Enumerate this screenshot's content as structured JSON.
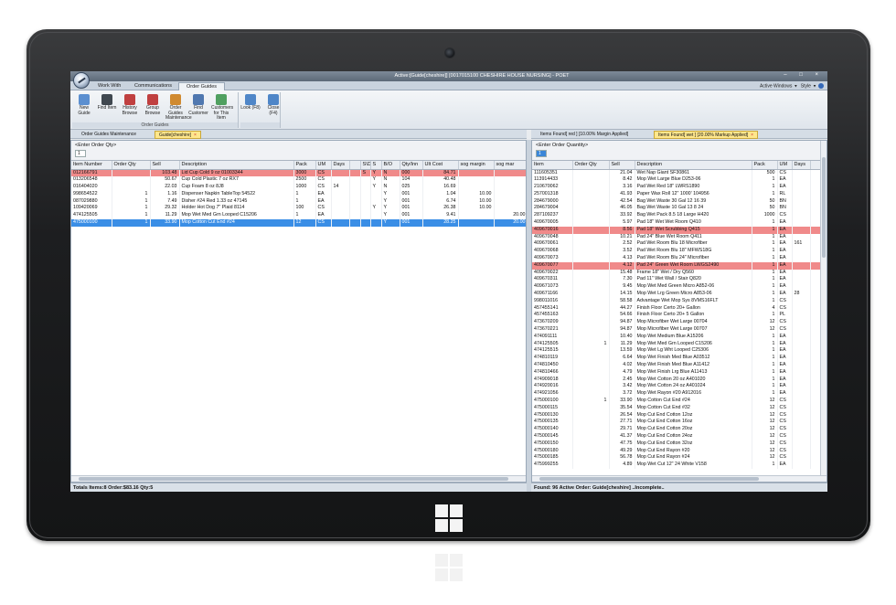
{
  "window": {
    "title": "Active:[Guide[cheshire]] [0017015100 CHESHIRE HOUSE NURSING] - POET",
    "controls": "– □ ×",
    "active_windows": "Active Windows",
    "style": "Style"
  },
  "ribbon_tabs": [
    "Work With",
    "Communications",
    "Order Guides"
  ],
  "ribbon": {
    "group_label": "Order Guides",
    "buttons": [
      {
        "label": "New Guide",
        "icon": "new-guide-icon",
        "color": "#5b8fd0"
      },
      {
        "label": "Find Item",
        "icon": "binoculars-icon",
        "color": "#404850"
      },
      {
        "label": "History Browse",
        "icon": "history-icon",
        "color": "#c04040"
      },
      {
        "label": "Group Browse",
        "icon": "group-icon",
        "color": "#c04040"
      },
      {
        "label": "Order Guides Maintenance",
        "icon": "tools-icon",
        "color": "#d08a30"
      },
      {
        "label": "Find Customer",
        "icon": "customer-icon",
        "color": "#5078b0"
      },
      {
        "label": "Customers for This Item",
        "icon": "customers-icon",
        "color": "#50a060"
      }
    ],
    "nav_buttons": [
      {
        "label": "Look (F8)",
        "icon": "magnifier-icon",
        "color": "#4f86c8"
      },
      {
        "label": "Close (F4)",
        "icon": "close-doc-icon",
        "color": "#4f86c8"
      }
    ]
  },
  "left": {
    "tabs": [
      {
        "label": "Order Guides Maintenance",
        "active": false
      },
      {
        "label": "Guide[cheshire]",
        "active": true
      }
    ],
    "enter_label": "<Enter Order Qty>",
    "entry_value": "1",
    "columns": [
      "Item Number",
      "Order Qty",
      "Sell",
      "Description",
      "Pack",
      "UM",
      "Days",
      "",
      "S\\D",
      "S",
      "B/O",
      "Qty/Inn",
      "Ult Cost",
      "sog margin",
      "sog mar"
    ],
    "rows": [
      {
        "style": "red",
        "cells": [
          "012166791",
          "",
          "103.48",
          "Lid Cup Cold 9 oz        01003344",
          "3000",
          "CS",
          "",
          "",
          "S",
          "Y",
          "N",
          "000",
          "84.71",
          "",
          ""
        ]
      },
      {
        "style": "",
        "cells": [
          "013206548",
          "",
          "50.67",
          "Cup Cold Plastic 7 oz           RX7",
          "2500",
          "CS",
          "",
          "",
          "",
          "Y",
          "N",
          "104",
          "40.48",
          "",
          ""
        ]
      },
      {
        "style": "",
        "cells": [
          "016404020",
          "",
          "22.03",
          "Cup Foam 8 oz                   8J8",
          "1000",
          "CS",
          "14",
          "",
          "",
          "Y",
          "N",
          "025",
          "16.69",
          "",
          ""
        ]
      },
      {
        "style": "",
        "cells": [
          "998654522",
          "1",
          "1.16",
          "Dispenser Napkin TableTop 54522",
          "1",
          "EA",
          "",
          "",
          "",
          "",
          "Y",
          "001",
          "1.04",
          "10.00",
          ""
        ]
      },
      {
        "style": "",
        "cells": [
          "087029880",
          "1",
          "7.49",
          "Disher #24 Red 1.33 oz     47145",
          "1",
          "EA",
          "",
          "",
          "",
          "",
          "Y",
          "001",
          "6.74",
          "10.00",
          ""
        ]
      },
      {
        "style": "",
        "cells": [
          "109420069",
          "1",
          "29.32",
          "Holder Hot Dog 7\" Plaid    8114",
          "100",
          "CS",
          "",
          "",
          "",
          "Y",
          "Y",
          "001",
          "26.38",
          "10.00",
          ""
        ]
      },
      {
        "style": "",
        "cells": [
          "474125505",
          "1",
          "11.29",
          "Mop Wet Med Grn Looped   C15206",
          "1",
          "EA",
          "",
          "",
          "",
          "",
          "Y",
          "001",
          "9.41",
          "",
          "20.00"
        ]
      },
      {
        "style": "sel",
        "cells": [
          "475000100",
          "1",
          "33.90",
          "Mop Cotton Cut End #24",
          "12",
          "CS",
          "",
          "",
          "",
          "",
          "Y",
          "001",
          "28.25",
          "",
          "20.00"
        ]
      }
    ],
    "status": "Totals Items:8 Order:$83.16 Qty:5"
  },
  "right": {
    "tabs": [
      {
        "label": "Items Found[ red ] [10.00% Margin Applied]",
        "active": false
      },
      {
        "label": "Items Found[ wet ] [20.00% Markup Applied]",
        "active": true
      }
    ],
    "enter_label": "<Enter Order Quantity>",
    "entry_value": "1",
    "columns": [
      "Item",
      "Order Qty",
      "Sell",
      "Description",
      "Pack",
      "UM",
      "Days",
      ""
    ],
    "rows": [
      {
        "style": "",
        "cells": [
          "111605351",
          "",
          "21.04",
          "Wet Nap Giant          SF30861",
          "500",
          "CS",
          "",
          ""
        ]
      },
      {
        "style": "",
        "cells": [
          "113914433",
          "",
          "8.42",
          "Mop Wet Large Blue      D253-06",
          "1",
          "EA",
          "",
          ""
        ]
      },
      {
        "style": "",
        "cells": [
          "210670062",
          "",
          "3.16",
          "Pad Wet Red 18\"         LWRS1890",
          "1",
          "EA",
          "",
          ""
        ]
      },
      {
        "style": "",
        "cells": [
          "257001318",
          "",
          "41.93",
          "Paper Wax Roll 12\" 1000' 104956",
          "1",
          "RL",
          "",
          ""
        ]
      },
      {
        "style": "",
        "cells": [
          "284679000",
          "",
          "42.54",
          "Bag Wet Waste 30 Gal 12 16 39",
          "50",
          "BN",
          "",
          ""
        ]
      },
      {
        "style": "",
        "cells": [
          "284679004",
          "",
          "46.05",
          "Bag Wet Waste 10 Gal 13 8 24",
          "50",
          "BN",
          "",
          ""
        ]
      },
      {
        "style": "",
        "cells": [
          "287109237",
          "",
          "33.92",
          "Bag Wet Pack 8.5 18 Large  H420",
          "1000",
          "CS",
          "",
          ""
        ]
      },
      {
        "style": "",
        "cells": [
          "409670005",
          "",
          "5.97",
          "Pad 18\" Wet Wet Room       Q410",
          "1",
          "EA",
          "",
          ""
        ]
      },
      {
        "style": "red",
        "cells": [
          "409670016",
          "",
          "8.56",
          "Pad 18\" Wet Scrubbing      Q415",
          "1",
          "EA",
          "",
          ""
        ]
      },
      {
        "style": "",
        "cells": [
          "409670048",
          "",
          "10.21",
          "Pad 24\" Blue Wet Room      Q411",
          "1",
          "EA",
          "",
          ""
        ]
      },
      {
        "style": "",
        "cells": [
          "409670061",
          "",
          "2.52",
          "Pad Wet Room Blu 18 Microfiber",
          "1",
          "EA",
          "161",
          ""
        ]
      },
      {
        "style": "",
        "cells": [
          "409670068",
          "",
          "3.52",
          "Pad Wet Room Blu 18\" MFWS18G",
          "1",
          "EA",
          "",
          ""
        ]
      },
      {
        "style": "",
        "cells": [
          "409670073",
          "",
          "4.13",
          "Pad Wet Room Blu 24\" Microfiber",
          "1",
          "EA",
          "",
          ""
        ]
      },
      {
        "style": "red",
        "cells": [
          "409670077",
          "",
          "4.12",
          "Pad 24\" Green Wet Room LWGS2490",
          "1",
          "EA",
          "",
          ""
        ]
      },
      {
        "style": "",
        "cells": [
          "409670022",
          "",
          "15.48",
          "Frame 18\" Wet / Dry       Q560",
          "1",
          "EA",
          "",
          ""
        ]
      },
      {
        "style": "",
        "cells": [
          "409670311",
          "",
          "7.30",
          "Pad 11\" Wet Wall / Stair   Q820",
          "1",
          "EA",
          "",
          ""
        ]
      },
      {
        "style": "",
        "cells": [
          "409671073",
          "",
          "9.45",
          "Mop Wet Med Green Micro A852-06",
          "1",
          "EA",
          "",
          ""
        ]
      },
      {
        "style": "",
        "cells": [
          "409671166",
          "",
          "14.15",
          "Mop Wet Lrg Green Micro A853-06",
          "1",
          "EA",
          "28",
          ""
        ]
      },
      {
        "style": "",
        "cells": [
          "998011016",
          "",
          "58.58",
          "Advantage Wet Mop Sys 8VMS16FLT",
          "1",
          "CS",
          "",
          ""
        ]
      },
      {
        "style": "",
        "cells": [
          "457455141",
          "",
          "44.27",
          "Finish Floor Certo 20+ Gallon",
          "4",
          "CS",
          "",
          ""
        ]
      },
      {
        "style": "",
        "cells": [
          "457455163",
          "",
          "54.66",
          "Finish Floor Certo 20+ 5 Gallon",
          "1",
          "PL",
          "",
          ""
        ]
      },
      {
        "style": "",
        "cells": [
          "473670209",
          "",
          "94.87",
          "Mop Microfiber Wet Large   00704",
          "12",
          "CS",
          "",
          ""
        ]
      },
      {
        "style": "",
        "cells": [
          "473670221",
          "",
          "94.87",
          "Mop Microfiber Wet Large   00707",
          "12",
          "CS",
          "",
          ""
        ]
      },
      {
        "style": "",
        "cells": [
          "474091111",
          "",
          "10.40",
          "Mop Wet Medium Blue        A15206",
          "1",
          "EA",
          "",
          ""
        ]
      },
      {
        "style": "",
        "cells": [
          "474125505",
          "1",
          "11.29",
          "Mop Wet Med Grn Looped   C15206",
          "1",
          "EA",
          "",
          ""
        ]
      },
      {
        "style": "",
        "cells": [
          "474125515",
          "",
          "13.59",
          "Mop Wet Lg Wht Looped     C25306",
          "1",
          "EA",
          "",
          ""
        ]
      },
      {
        "style": "",
        "cells": [
          "474810119",
          "",
          "6.64",
          "Mop Wet Finish Med Blue   A03512",
          "1",
          "EA",
          "",
          ""
        ]
      },
      {
        "style": "",
        "cells": [
          "474810450",
          "",
          "4.02",
          "Mop Wet Finish Med Blue   A11412",
          "1",
          "EA",
          "",
          ""
        ]
      },
      {
        "style": "",
        "cells": [
          "474810466",
          "",
          "4.79",
          "Mop Wet Finish Lrg Blue   A11413",
          "1",
          "EA",
          "",
          ""
        ]
      },
      {
        "style": "",
        "cells": [
          "474909018",
          "",
          "2.45",
          "Mop Wet Cotton 20 oz      A401020",
          "1",
          "EA",
          "",
          ""
        ]
      },
      {
        "style": "",
        "cells": [
          "474920016",
          "",
          "3.42",
          "Mop Wet Cotton 24 oz      A401024",
          "1",
          "EA",
          "",
          ""
        ]
      },
      {
        "style": "",
        "cells": [
          "474921056",
          "",
          "3.72",
          "Mop Wet Rayon #20         A912016",
          "1",
          "EA",
          "",
          ""
        ]
      },
      {
        "style": "",
        "cells": [
          "475000100",
          "1",
          "33.90",
          "Mop Cotton Cut End #24",
          "12",
          "CS",
          "",
          ""
        ]
      },
      {
        "style": "",
        "cells": [
          "475000115",
          "",
          "35.54",
          "Mop Cotton Cut End #32",
          "12",
          "CS",
          "",
          ""
        ]
      },
      {
        "style": "",
        "cells": [
          "475000130",
          "",
          "26.54",
          "Mop Cut End Cotton 12oz",
          "12",
          "CS",
          "",
          ""
        ]
      },
      {
        "style": "",
        "cells": [
          "475000135",
          "",
          "27.71",
          "Mop Cut End Cotton 16oz",
          "12",
          "CS",
          "",
          ""
        ]
      },
      {
        "style": "",
        "cells": [
          "475000140",
          "",
          "29.71",
          "Mop Cut End Cotton 20oz",
          "12",
          "CS",
          "",
          ""
        ]
      },
      {
        "style": "",
        "cells": [
          "475000145",
          "",
          "41.37",
          "Mop Cut End Cotton 24oz",
          "12",
          "CS",
          "",
          ""
        ]
      },
      {
        "style": "",
        "cells": [
          "475000150",
          "",
          "47.75",
          "Mop Cut End Cotton 32oz",
          "12",
          "CS",
          "",
          ""
        ]
      },
      {
        "style": "",
        "cells": [
          "475000180",
          "",
          "49.29",
          "Mop Cut End Rayon #20",
          "12",
          "CS",
          "",
          ""
        ]
      },
      {
        "style": "",
        "cells": [
          "475000185",
          "",
          "56.78",
          "Mop Cut End Rayon #24",
          "12",
          "CS",
          "",
          ""
        ]
      },
      {
        "style": "",
        "cells": [
          "475999255",
          "",
          "4.89",
          "Mop Wet Cut 12\" 24 White  V158",
          "1",
          "EA",
          "",
          ""
        ]
      }
    ],
    "status": "Found: 96   Active Order: Guide[cheshire] ..Incomplete.."
  }
}
